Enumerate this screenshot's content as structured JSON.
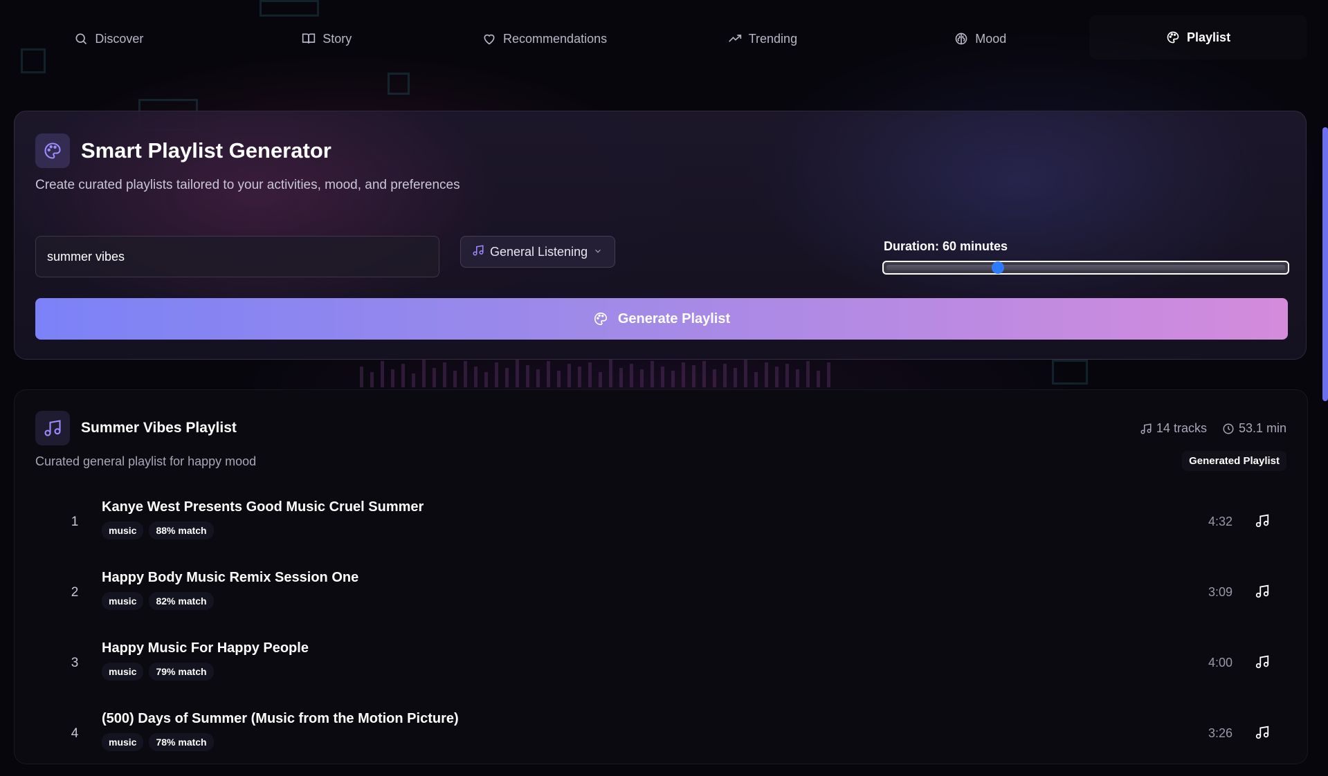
{
  "nav": {
    "items": [
      {
        "label": "Discover",
        "icon": "search-icon"
      },
      {
        "label": "Story",
        "icon": "book-icon"
      },
      {
        "label": "Recommendations",
        "icon": "heart-icon"
      },
      {
        "label": "Trending",
        "icon": "trending-up-icon"
      },
      {
        "label": "Mood",
        "icon": "brain-icon"
      },
      {
        "label": "Playlist",
        "icon": "palette-icon",
        "active": true
      }
    ]
  },
  "generator": {
    "title": "Smart Playlist Generator",
    "subtitle": "Create curated playlists tailored to your activities, mood, and preferences",
    "search_value": "summer vibes",
    "activity_selected": "General Listening",
    "duration_label": "Duration: 60 minutes",
    "duration_fraction": 0.28,
    "button_label": "Generate Playlist"
  },
  "playlist": {
    "title": "Summer Vibes Playlist",
    "subtitle": "Curated general playlist for happy mood",
    "tracks_count": "14 tracks",
    "total_duration": "53.1 min",
    "badge": "Generated Playlist",
    "tracks": [
      {
        "num": "1",
        "title": "Kanye West Presents Good Music Cruel Summer",
        "tag": "music",
        "match": "88% match",
        "duration": "4:32"
      },
      {
        "num": "2",
        "title": "Happy Body Music Remix Session One",
        "tag": "music",
        "match": "82% match",
        "duration": "3:09"
      },
      {
        "num": "3",
        "title": "Happy Music For Happy People",
        "tag": "music",
        "match": "79% match",
        "duration": "4:00"
      },
      {
        "num": "4",
        "title": "(500) Days of Summer (Music from the Motion Picture)",
        "tag": "music",
        "match": "78% match",
        "duration": "3:26"
      }
    ]
  },
  "colors": {
    "accent": "#7b82f7",
    "accent_end": "#d48bdc",
    "slider_thumb": "#2f7bff",
    "background": "#07060c"
  }
}
